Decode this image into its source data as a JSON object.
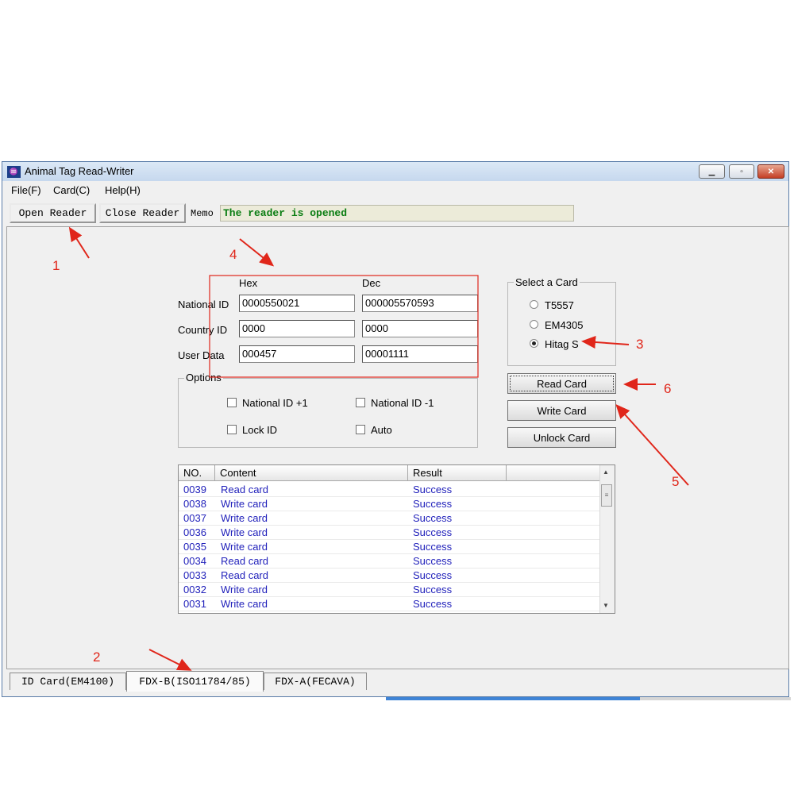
{
  "window": {
    "title": "Animal Tag Read-Writer",
    "icon": "app-icon"
  },
  "menu": [
    "File(F)",
    "Card(C)",
    "Help(H)"
  ],
  "toolbar": {
    "open_label": "Open Reader",
    "close_label": "Close Reader",
    "memo_label": "Memo",
    "memo_value": "The reader is opened"
  },
  "fields": {
    "hex_header": "Hex",
    "dec_header": "Dec",
    "rows": [
      {
        "label": "National ID",
        "hex": "0000550021",
        "dec": "000005570593"
      },
      {
        "label": "Country ID",
        "hex": "0000",
        "dec": "0000"
      },
      {
        "label": "User Data",
        "hex": "000457",
        "dec": "00001111"
      }
    ]
  },
  "options": {
    "title": "Options",
    "items": [
      {
        "label": "National ID +1",
        "checked": false
      },
      {
        "label": "National ID -1",
        "checked": false
      },
      {
        "label": "Lock ID",
        "checked": false
      },
      {
        "label": "Auto",
        "checked": false
      }
    ]
  },
  "card_select": {
    "title": "Select a Card",
    "options": [
      {
        "label": "T5557",
        "selected": false
      },
      {
        "label": "EM4305",
        "selected": false
      },
      {
        "label": "Hitag S",
        "selected": true
      }
    ]
  },
  "actions": {
    "read": "Read Card",
    "write": "Write Card",
    "unlock": "Unlock Card"
  },
  "log": {
    "columns": [
      "NO.",
      "Content",
      "Result"
    ],
    "rows": [
      {
        "no": "0039",
        "content": "Read card",
        "result": "Success"
      },
      {
        "no": "0038",
        "content": "Write card",
        "result": "Success"
      },
      {
        "no": "0037",
        "content": "Write card",
        "result": "Success"
      },
      {
        "no": "0036",
        "content": "Write card",
        "result": "Success"
      },
      {
        "no": "0035",
        "content": "Write card",
        "result": "Success"
      },
      {
        "no": "0034",
        "content": "Read card",
        "result": "Success"
      },
      {
        "no": "0033",
        "content": "Read card",
        "result": "Success"
      },
      {
        "no": "0032",
        "content": "Write card",
        "result": "Success"
      },
      {
        "no": "0031",
        "content": "Write card",
        "result": "Success"
      }
    ]
  },
  "tabs": [
    {
      "label": "ID Card(EM4100)",
      "active": false
    },
    {
      "label": "FDX-B(ISO11784/85)",
      "active": true
    },
    {
      "label": "FDX-A(FECAVA)",
      "active": false
    }
  ],
  "annotations": [
    "1",
    "2",
    "3",
    "4",
    "5",
    "6"
  ],
  "colors": {
    "annotation": "#e0261a",
    "memo_text": "#0a7d12",
    "log_text": "#2222bb",
    "title_bar": "#c6d8ee"
  }
}
